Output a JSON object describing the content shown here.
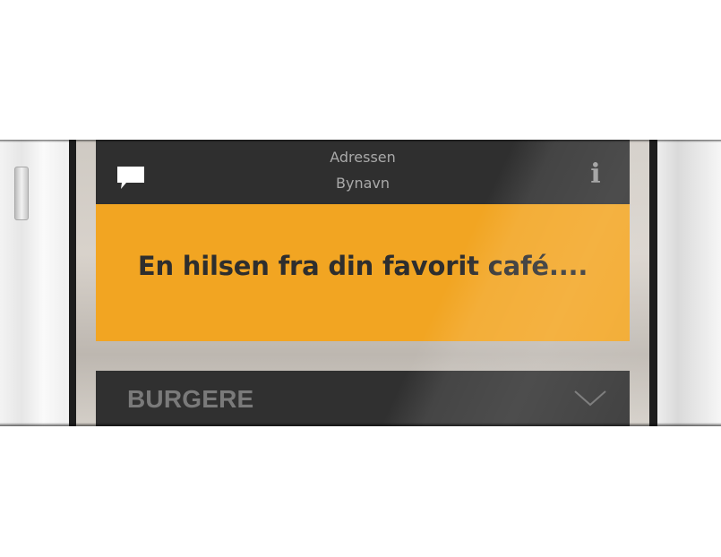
{
  "header": {
    "address_line1": "Adressen",
    "address_line2": "Bynavn",
    "chat_icon": "chat-bubble-icon",
    "info_icon": "info-icon",
    "info_glyph": "i"
  },
  "banner": {
    "message": "En hilsen fra din favorit café...."
  },
  "menu": {
    "category_label": "BURGERE",
    "expand_icon": "chevron-down-icon"
  },
  "colors": {
    "header_bg": "#2f2f2f",
    "accent": "#f2a522",
    "text_dark": "#2e2e2e",
    "muted_text": "#a9a9a9",
    "category_bg": "#303030"
  }
}
